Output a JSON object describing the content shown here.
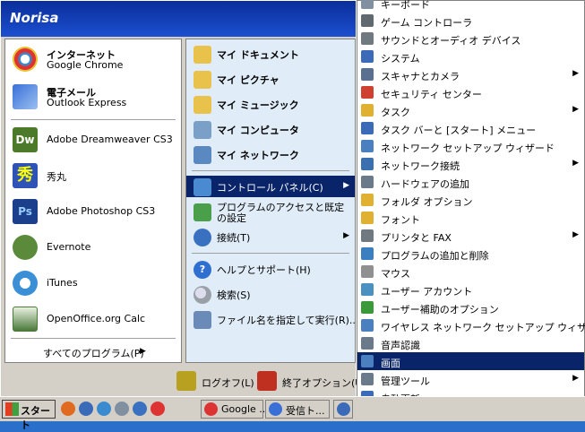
{
  "user_name": "Norisa",
  "left_items": [
    {
      "line1": "インターネット",
      "line2": "Google Chrome",
      "icon": "chrome-icon",
      "color": "#d33"
    },
    {
      "line1": "電子メール",
      "line2": "Outlook Express",
      "icon": "outlook-icon",
      "color": "#3a6fd8"
    },
    {
      "label": "Adobe Dreamweaver CS3",
      "icon": "dreamweaver-icon",
      "color": "#4a7a2a"
    },
    {
      "label": "秀丸",
      "icon": "hidemaru-icon",
      "color": "#2d52b8"
    },
    {
      "label": "Adobe Photoshop CS3",
      "icon": "photoshop-icon",
      "color": "#1c3f8c"
    },
    {
      "label": "Evernote",
      "icon": "evernote-icon",
      "color": "#5a8a3a"
    },
    {
      "label": "iTunes",
      "icon": "itunes-icon",
      "color": "#3b8fd6"
    },
    {
      "label": "OpenOffice.org Calc",
      "icon": "oocalc-icon",
      "color": "#4a7a3a"
    }
  ],
  "all_programs": "すべてのプログラム(P)",
  "right_items": [
    {
      "label": "マイ ドキュメント",
      "icon": "my-documents-icon",
      "color": "#e8c24a",
      "bold": true
    },
    {
      "label": "マイ ピクチャ",
      "icon": "my-pictures-icon",
      "color": "#e8c24a",
      "bold": true
    },
    {
      "label": "マイ ミュージック",
      "icon": "my-music-icon",
      "color": "#e8c24a",
      "bold": true
    },
    {
      "label": "マイ コンピュータ",
      "icon": "my-computer-icon",
      "color": "#7aa0c8",
      "bold": true
    },
    {
      "label": "マイ ネットワーク",
      "icon": "my-network-icon",
      "color": "#5a88c0",
      "bold": true
    },
    {
      "label": "コントロール パネル(C)",
      "icon": "control-panel-icon",
      "color": "#4a8ad0",
      "selected": true,
      "arrow": true
    },
    {
      "label": "プログラムのアクセスと既定の設定",
      "icon": "program-access-icon",
      "color": "#4aa04a"
    },
    {
      "label": "接続(T)",
      "icon": "connect-icon",
      "color": "#3a70c0",
      "arrow": true
    },
    {
      "label": "ヘルプとサポート(H)",
      "icon": "help-icon",
      "color": "#2f6fd0"
    },
    {
      "label": "検索(S)",
      "icon": "search-icon",
      "color": "#9aa0a8"
    },
    {
      "label": "ファイル名を指定して実行(R)...",
      "icon": "run-icon",
      "color": "#6a8ab8"
    }
  ],
  "logoff": "ログオフ(L)",
  "shutdown": "終了オプション(U)",
  "submenu": [
    {
      "label": "キーボード",
      "icon": "keyboard-icon",
      "color": "#8090a0"
    },
    {
      "label": "ゲーム コントローラ",
      "icon": "game-controller-icon",
      "color": "#606870"
    },
    {
      "label": "サウンドとオーディオ デバイス",
      "icon": "sound-icon",
      "color": "#707880"
    },
    {
      "label": "システム",
      "icon": "system-icon",
      "color": "#3a6ab8"
    },
    {
      "label": "スキャナとカメラ",
      "icon": "scanner-icon",
      "color": "#5a7090",
      "arrow": true
    },
    {
      "label": "セキュリティ センター",
      "icon": "security-center-icon",
      "color": "#d04030"
    },
    {
      "label": "タスク",
      "icon": "tasks-icon",
      "color": "#e0b030",
      "arrow": true
    },
    {
      "label": "タスク バーと [スタート] メニュー",
      "icon": "taskbar-icon",
      "color": "#3a6ab8"
    },
    {
      "label": "ネットワーク セットアップ ウィザード",
      "icon": "network-wizard-icon",
      "color": "#4a80c0"
    },
    {
      "label": "ネットワーク接続",
      "icon": "network-connections-icon",
      "color": "#3a70b0",
      "arrow": true
    },
    {
      "label": "ハードウェアの追加",
      "icon": "add-hardware-icon",
      "color": "#6a7a8a"
    },
    {
      "label": "フォルダ オプション",
      "icon": "folder-options-icon",
      "color": "#e0b030"
    },
    {
      "label": "フォント",
      "icon": "fonts-icon",
      "color": "#e0b030"
    },
    {
      "label": "プリンタと FAX",
      "icon": "printer-icon",
      "color": "#707880",
      "arrow": true
    },
    {
      "label": "プログラムの追加と削除",
      "icon": "add-remove-icon",
      "color": "#3a80c0"
    },
    {
      "label": "マウス",
      "icon": "mouse-icon",
      "color": "#909090"
    },
    {
      "label": "ユーザー アカウント",
      "icon": "user-accounts-icon",
      "color": "#4a90c0"
    },
    {
      "label": "ユーザー補助のオプション",
      "icon": "accessibility-icon",
      "color": "#3a9a3a"
    },
    {
      "label": "ワイヤレス ネットワーク セットアップ ウィザード",
      "icon": "wireless-icon",
      "color": "#4a80c0"
    },
    {
      "label": "音声認識",
      "icon": "speech-icon",
      "color": "#6a7a8a"
    },
    {
      "label": "画面",
      "icon": "display-icon",
      "color": "#4a80c0",
      "selected": true
    },
    {
      "label": "管理ツール",
      "icon": "admin-tools-icon",
      "color": "#6a7a8a",
      "arrow": true
    },
    {
      "label": "自動更新",
      "icon": "auto-update-icon",
      "color": "#3a6ab8"
    }
  ],
  "taskbar": {
    "start": "スタート",
    "quicklaunch": [
      {
        "icon": "firefox-icon",
        "color": "#e06a20"
      },
      {
        "icon": "explorer-icon",
        "color": "#3a6ab8"
      },
      {
        "icon": "ie-icon",
        "color": "#3a8ad0"
      },
      {
        "icon": "notepad-icon",
        "color": "#8090a0"
      },
      {
        "icon": "media-player-icon",
        "color": "#3a70c0"
      },
      {
        "icon": "chrome-icon",
        "color": "#d33"
      }
    ],
    "tasks": [
      {
        "label": "Google ...",
        "icon": "chrome-icon",
        "color": "#d33"
      },
      {
        "label": "受信ト...",
        "icon": "outlook-icon",
        "color": "#3a6fd8"
      },
      {
        "label": "",
        "icon": "window-icon",
        "color": "#3a6ab8"
      }
    ]
  }
}
